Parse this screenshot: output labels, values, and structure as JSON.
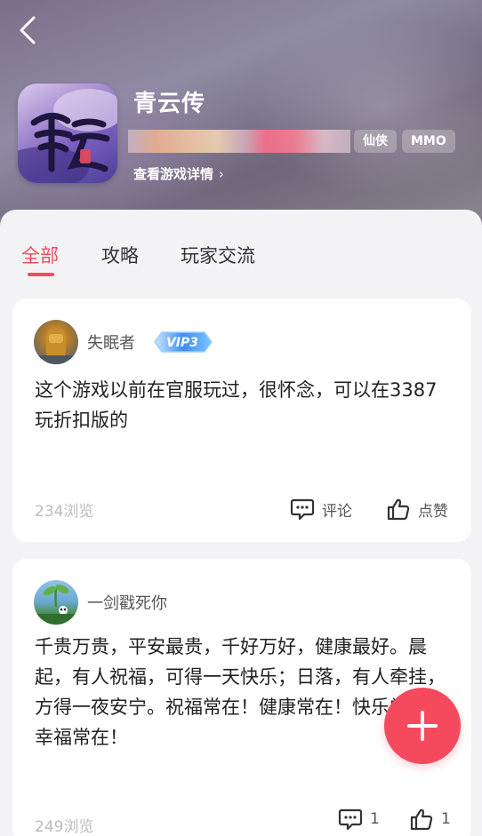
{
  "game": {
    "name": "青云传",
    "tags": [
      "仙侠",
      "MMO"
    ],
    "details_link": "查看游戏详情",
    "details_chevron": "›"
  },
  "tabs": [
    {
      "label": "全部",
      "active": true
    },
    {
      "label": "攻略",
      "active": false
    },
    {
      "label": "玩家交流",
      "active": false
    }
  ],
  "posts": [
    {
      "username": "失眠者",
      "vip_badge": "VIP3",
      "text": "这个游戏以前在官服玩过，很怀念，可以在3387玩折扣版的",
      "views": "234浏览",
      "comment_label": "评论",
      "like_label": "点赞"
    },
    {
      "username": "一剑戳死你",
      "text": "千贵万贵，平安最贵，千好万好，健康最好。晨起，有人祝福，可得一天快乐；日落，有人牵挂，方得一夜安宁。祝福常在！健康常在！快乐常在！幸福常在！",
      "views": "249浏览",
      "comment_count": "1",
      "like_count": "1"
    }
  ],
  "colors": {
    "accent": "#f54a5e",
    "muted_text": "#bbbbbb"
  },
  "icons": {
    "back": "chevron-left-icon",
    "comment": "comment-icon",
    "like": "thumbs-up-icon",
    "fab": "plus-icon"
  }
}
